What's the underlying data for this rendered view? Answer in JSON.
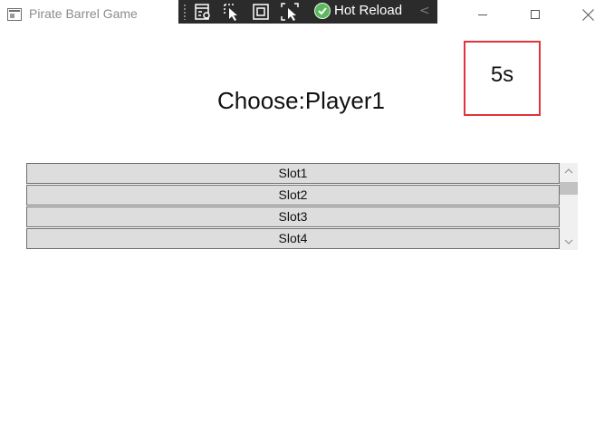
{
  "window": {
    "title": "Pirate Barrel Game",
    "icon": "app-window-icon"
  },
  "devbar": {
    "hot_reload_label": "Hot Reload",
    "tools": [
      "live-visual-tree-icon",
      "select-element-icon",
      "display-layout-adorners-icon",
      "track-focus-icon"
    ],
    "collapse_glyph": "<"
  },
  "window_controls": [
    "minimize",
    "maximize",
    "close"
  ],
  "timer": {
    "text": "5s",
    "border_color": "#e0343a"
  },
  "prompt": {
    "text": "Choose:Player1"
  },
  "slots": [
    {
      "label": "Slot1"
    },
    {
      "label": "Slot2"
    },
    {
      "label": "Slot3"
    },
    {
      "label": "Slot4"
    }
  ],
  "scrollbar": {
    "up_glyph": "⌃",
    "down_glyph": "⌄"
  }
}
